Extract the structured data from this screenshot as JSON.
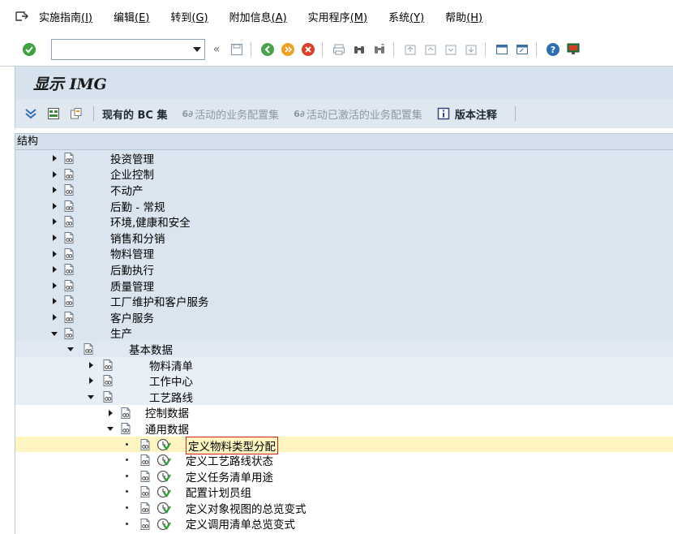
{
  "menu": {
    "items": [
      {
        "text": "实施指南",
        "accel": "(I)"
      },
      {
        "text": "编辑",
        "accel": "(E)"
      },
      {
        "text": "转到",
        "accel": "(G)"
      },
      {
        "text": "附加信息",
        "accel": "(A)"
      },
      {
        "text": "实用程序",
        "accel": "(M)"
      },
      {
        "text": "系统",
        "accel": "(Y)"
      },
      {
        "text": "帮助",
        "accel": "(H)"
      }
    ]
  },
  "toolbar": {
    "command_value": "",
    "back_symbol": "«"
  },
  "screen": {
    "title": "显示 IMG"
  },
  "app_toolbar": {
    "existing_bc_sets": "现有的 BC 集",
    "active_bc_sets": "活动的业务配置集",
    "activated_bc_sets": "活动已激活的业务配置集",
    "release_notes": "版本注释",
    "glasses_symbol": "6∂"
  },
  "tree": {
    "header": "结构",
    "nodes": [
      {
        "label": "投资管理",
        "level": 0,
        "state": "collapsed"
      },
      {
        "label": "企业控制",
        "level": 0,
        "state": "collapsed"
      },
      {
        "label": "不动产",
        "level": 0,
        "state": "collapsed"
      },
      {
        "label": "后勤 - 常规",
        "level": 0,
        "state": "collapsed"
      },
      {
        "label": "环境,健康和安全",
        "level": 0,
        "state": "collapsed"
      },
      {
        "label": "销售和分销",
        "level": 0,
        "state": "collapsed"
      },
      {
        "label": "物料管理",
        "level": 0,
        "state": "collapsed"
      },
      {
        "label": "后勤执行",
        "level": 0,
        "state": "collapsed"
      },
      {
        "label": "质量管理",
        "level": 0,
        "state": "collapsed"
      },
      {
        "label": "工厂维护和客户服务",
        "level": 0,
        "state": "collapsed"
      },
      {
        "label": "客户服务",
        "level": 0,
        "state": "collapsed"
      },
      {
        "label": "生产",
        "level": 0,
        "state": "expanded"
      },
      {
        "label": "基本数据",
        "level": 1,
        "state": "expanded"
      },
      {
        "label": "物料清单",
        "level": 2,
        "state": "collapsed"
      },
      {
        "label": "工作中心",
        "level": 2,
        "state": "collapsed"
      },
      {
        "label": "工艺路线",
        "level": 2,
        "state": "expanded"
      },
      {
        "label": "控制数据",
        "level": 3,
        "state": "collapsed"
      },
      {
        "label": "通用数据",
        "level": 3,
        "state": "expanded"
      },
      {
        "label": "定义物料类型分配",
        "level": 4,
        "state": "leaf",
        "selected": true
      },
      {
        "label": "定义工艺路线状态",
        "level": 4,
        "state": "leaf"
      },
      {
        "label": "定义任务清单用途",
        "level": 4,
        "state": "leaf"
      },
      {
        "label": "配置计划员组",
        "level": 4,
        "state": "leaf"
      },
      {
        "label": "定义对象视图的总览变式",
        "level": 4,
        "state": "leaf"
      },
      {
        "label": "定义调用清单总览变式",
        "level": 4,
        "state": "leaf"
      }
    ]
  },
  "colors": {
    "selected_row": "#fff5c0",
    "selection_border": "#d82020",
    "title_bg": "#d6e2ee",
    "tree_header_bg": "#d4e0ec"
  }
}
